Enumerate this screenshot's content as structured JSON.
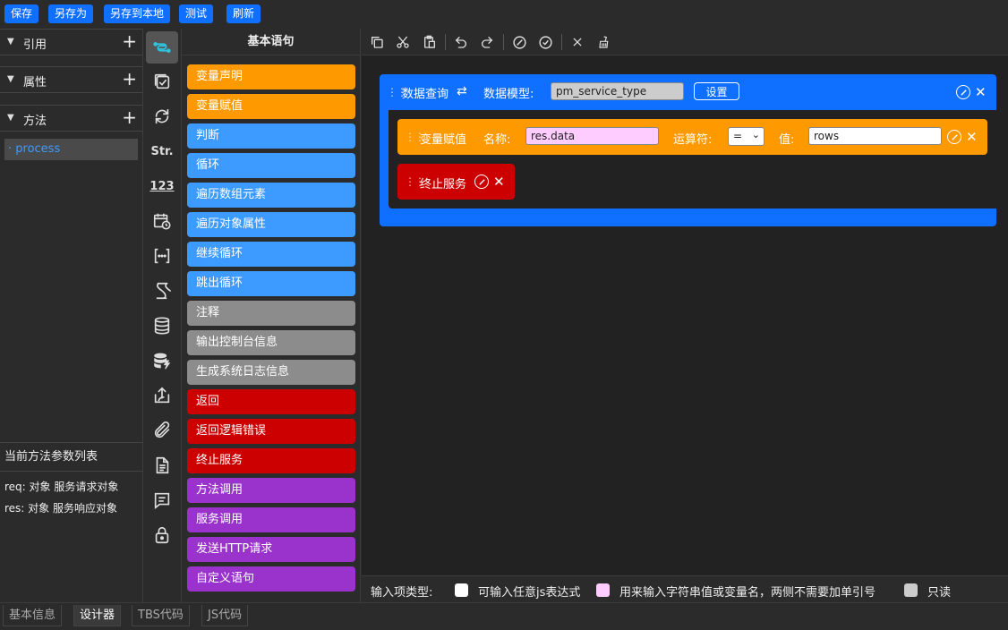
{
  "toolbar": {
    "save": "保存",
    "save_as": "另存为",
    "save_local": "另存到本地",
    "test": "测试",
    "refresh": "刷新"
  },
  "left": {
    "sections": [
      {
        "label": "引用",
        "icon": "plus-icon"
      },
      {
        "label": "属性",
        "icon": "plus-icon"
      },
      {
        "label": "方法",
        "icon": "plus-icon"
      }
    ],
    "methods": [
      "· process"
    ],
    "params_title": "当前方法参数列表",
    "params": [
      "req: 对象 服务请求对象",
      "res: 对象 服务响应对象"
    ]
  },
  "icons": [
    "link-transform-icon",
    "checkbox-icon",
    "loop-arrows-icon",
    "string-icon",
    "number-icon",
    "calendar-clock-icon",
    "brackets-icon",
    "script-icon",
    "database-icon",
    "database-lightning-icon",
    "export-icon",
    "paperclip-icon",
    "document-icon",
    "message-icon",
    "lock-icon"
  ],
  "icon_texts": {
    "string": "Str.",
    "number": "123"
  },
  "palette": {
    "title": "基本语句",
    "items": [
      {
        "label": "变量声明",
        "color": "#ff9900"
      },
      {
        "label": "变量赋值",
        "color": "#ff9900"
      },
      {
        "label": "判断",
        "color": "#3d9bff"
      },
      {
        "label": "循环",
        "color": "#3d9bff"
      },
      {
        "label": "遍历数组元素",
        "color": "#3d9bff"
      },
      {
        "label": "遍历对象属性",
        "color": "#3d9bff"
      },
      {
        "label": "继续循环",
        "color": "#3d9bff"
      },
      {
        "label": "跳出循环",
        "color": "#3d9bff"
      },
      {
        "label": "注释",
        "color": "#8c8c8c"
      },
      {
        "label": "输出控制台信息",
        "color": "#8c8c8c"
      },
      {
        "label": "生成系统日志信息",
        "color": "#8c8c8c"
      },
      {
        "label": "返回",
        "color": "#cc0000"
      },
      {
        "label": "返回逻辑错误",
        "color": "#cc0000"
      },
      {
        "label": "终止服务",
        "color": "#cc0000"
      },
      {
        "label": "方法调用",
        "color": "#9933cc"
      },
      {
        "label": "服务调用",
        "color": "#9933cc"
      },
      {
        "label": "发送HTTP请求",
        "color": "#9933cc"
      },
      {
        "label": "自定义语句",
        "color": "#9933cc"
      }
    ]
  },
  "editor": {
    "query_block": {
      "title": "数据查询",
      "model_label": "数据模型:",
      "model_value": "pm_service_type",
      "settings_button": "设置",
      "color": "#0f6fff"
    },
    "assign_block": {
      "title": "变量赋值",
      "name_label": "名称:",
      "name_value": "res.data",
      "operator_label": "运算符:",
      "operator_value": "=",
      "value_label": "值:",
      "value_value": "rows",
      "color": "#ff9900"
    },
    "stop_block": {
      "title": "终止服务",
      "color": "#cc0000"
    }
  },
  "legend": {
    "title": "输入项类型:",
    "items": [
      {
        "color": "#ffffff",
        "label": "可输入任意js表达式"
      },
      {
        "color": "#ffccff",
        "label": "用来输入字符串值或变量名，两侧不需要加单引号"
      },
      {
        "color": "#cccccc",
        "label": "只读"
      }
    ]
  },
  "bottom_tabs": [
    "基本信息",
    "设计器",
    "TBS代码",
    "JS代码"
  ],
  "active_tab": "设计器"
}
